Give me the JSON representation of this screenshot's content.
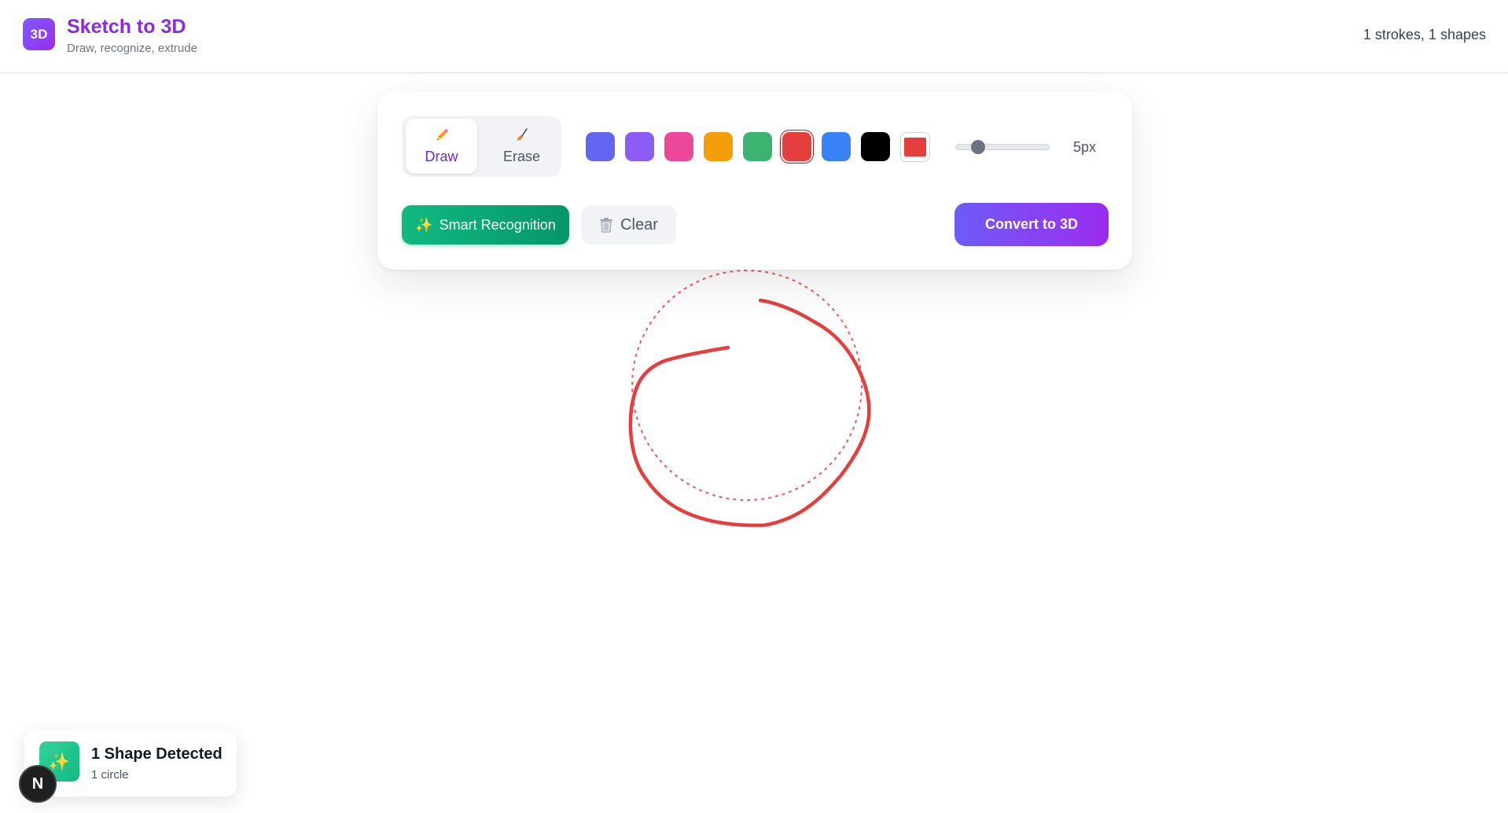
{
  "header": {
    "logo_text": "3D",
    "title": "Sketch to 3D",
    "subtitle": "Draw, recognize, extrude",
    "stats": "1 strokes, 1 shapes"
  },
  "toolbar": {
    "modes": [
      {
        "label": "Draw",
        "icon": "pencil-icon",
        "active": true
      },
      {
        "label": "Erase",
        "icon": "brush-icon",
        "active": false
      }
    ],
    "colors": [
      "#6366f1",
      "#8b5cf6",
      "#ec4899",
      "#f59e0b",
      "#3cb371",
      "#e53e3e",
      "#3b82f6",
      "#000000"
    ],
    "selected_color": "#e53e3e",
    "custom_color": "#e53e3e",
    "brush_size": {
      "value": 5,
      "min": 1,
      "max": 30,
      "label": "5px"
    },
    "smart_label": "Smart Recognition",
    "smart_icon": "✨",
    "clear_label": "Clear",
    "convert_label": "Convert to 3D"
  },
  "canvas": {
    "stroke_color": "#e53e3e",
    "detected_shape": "circle"
  },
  "notification": {
    "icon": "✨",
    "title": "1 Shape Detected",
    "detail": "1 circle"
  },
  "dev_badge": "N"
}
